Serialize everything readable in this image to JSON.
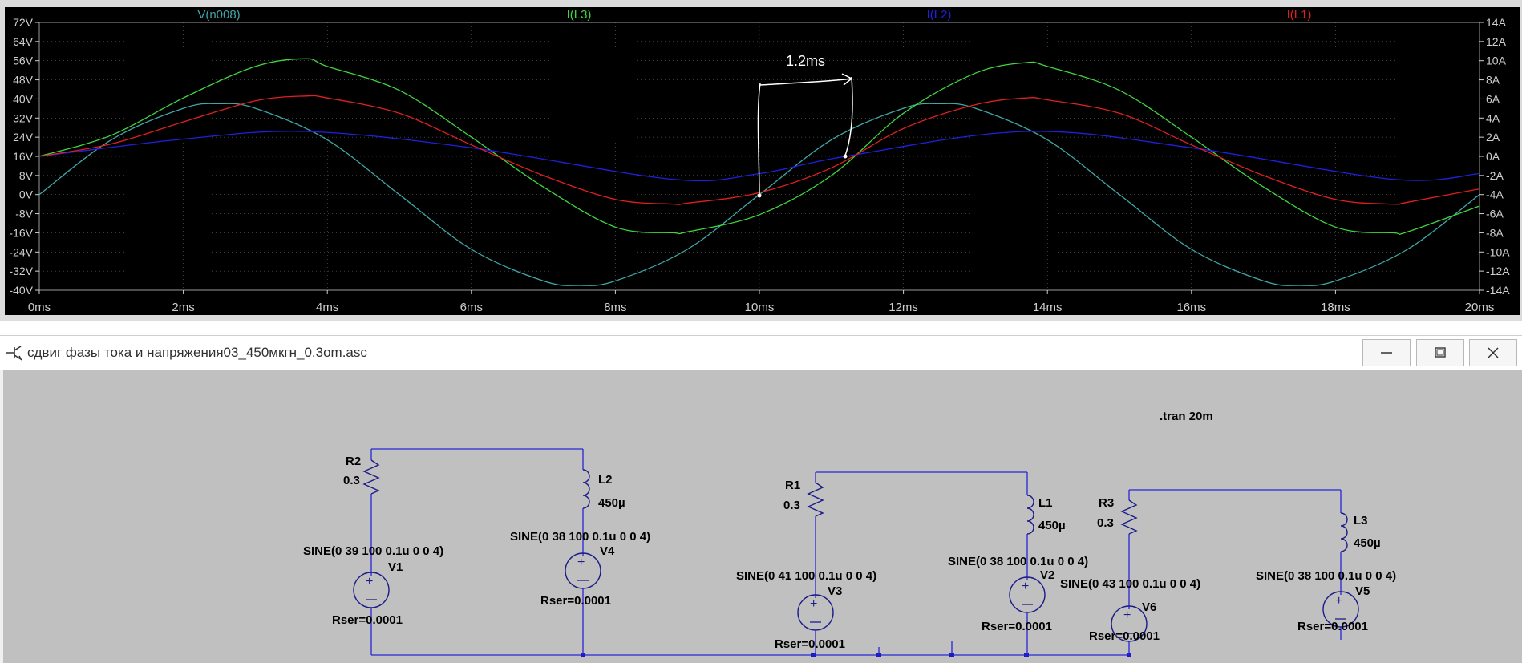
{
  "plot": {
    "legend": [
      {
        "label": "V(n008)",
        "color": "#3fa7a7"
      },
      {
        "label": "I(L3)",
        "color": "#3fd63f"
      },
      {
        "label": "I(L2)",
        "color": "#2020e0"
      },
      {
        "label": "I(L1)",
        "color": "#e02020"
      }
    ],
    "left_axis_ticks": [
      "72V",
      "64V",
      "56V",
      "48V",
      "40V",
      "32V",
      "24V",
      "16V",
      "8V",
      "0V",
      "-8V",
      "-16V",
      "-24V",
      "-32V",
      "-40V"
    ],
    "right_axis_ticks": [
      "14A",
      "12A",
      "10A",
      "8A",
      "6A",
      "4A",
      "2A",
      "0A",
      "-2A",
      "-4A",
      "-6A",
      "-8A",
      "-10A",
      "-12A",
      "-14A"
    ],
    "x_axis_ticks": [
      "0ms",
      "2ms",
      "4ms",
      "6ms",
      "8ms",
      "10ms",
      "12ms",
      "14ms",
      "16ms",
      "18ms",
      "20ms"
    ],
    "annotation": "1.2ms",
    "colors": {
      "background": "#000000",
      "grid": "#7a7a7a",
      "frame": "#9a9a9a",
      "annotation": "#ffffff"
    }
  },
  "chart_data": {
    "type": "line",
    "x_unit": "ms",
    "xlim": [
      0,
      20
    ],
    "left_ylim": [
      -40,
      72
    ],
    "right_ylim": [
      -14,
      14
    ],
    "series": [
      {
        "name": "V(n008)",
        "axis": "left",
        "unit": "V",
        "color": "#3fa7a7",
        "x": [
          0,
          1,
          2,
          2.5,
          3,
          4,
          5,
          6,
          7,
          7.5,
          8,
          9,
          10,
          11,
          12,
          12.5,
          13,
          14,
          15,
          16,
          17,
          17.5,
          18,
          19,
          20
        ],
        "y": [
          0,
          22.9,
          36.1,
          38,
          36.1,
          22.9,
          0,
          -22.9,
          -36.1,
          -38,
          -36.1,
          -22.9,
          0,
          22.9,
          36.1,
          38,
          36.1,
          22.9,
          0,
          -22.9,
          -36.1,
          -38,
          -36.1,
          -22.9,
          0
        ]
      },
      {
        "name": "I(L3)",
        "axis": "right",
        "unit": "A",
        "color": "#3fd63f",
        "x": [
          0,
          1,
          2,
          3,
          3.7,
          4,
          5,
          6,
          7,
          8,
          8.8,
          9,
          10,
          11,
          12,
          13,
          13.7,
          14,
          15,
          16,
          17,
          18,
          18.8,
          19,
          20
        ],
        "y": [
          0,
          2.2,
          6.1,
          9.4,
          10.2,
          9.4,
          6.9,
          2.0,
          -3.2,
          -7.4,
          -8.0,
          -7.9,
          -6.1,
          -2.0,
          4.5,
          8.7,
          9.8,
          9.4,
          6.9,
          2.0,
          -3.2,
          -7.4,
          -8.0,
          -7.9,
          -5.2
        ]
      },
      {
        "name": "I(L2)",
        "axis": "right",
        "unit": "A",
        "color": "#2020e0",
        "x": [
          0,
          2,
          3.7,
          6,
          8.8,
          10,
          11.2,
          13.7,
          16,
          18.8,
          20
        ],
        "y": [
          0,
          1.8,
          2.6,
          0.9,
          -2.4,
          -1.8,
          0,
          2.6,
          0.9,
          -2.4,
          -1.8
        ]
      },
      {
        "name": "I(L1)",
        "axis": "right",
        "unit": "A",
        "color": "#e02020",
        "x": [
          0,
          1,
          2,
          3,
          3.7,
          4,
          5,
          6,
          7,
          8,
          8.8,
          9,
          10,
          11,
          12,
          13,
          13.7,
          14,
          15,
          16,
          17,
          18,
          18.8,
          19,
          20
        ],
        "y": [
          0,
          1.3,
          3.6,
          5.8,
          6.3,
          6.1,
          4.5,
          1.2,
          -2.0,
          -4.5,
          -5.0,
          -4.9,
          -3.8,
          -1.2,
          2.9,
          5.4,
          6.1,
          5.9,
          4.5,
          1.2,
          -2.0,
          -4.5,
          -5.0,
          -4.8,
          -3.4
        ]
      }
    ]
  },
  "schematic_window": {
    "title": "сдвиг фазы тока и напряжения03_450мкгн_0.3om.asc",
    "directive": ".tran 20m",
    "components": {
      "R2": {
        "name": "R2",
        "value": "0.3"
      },
      "L2": {
        "name": "L2",
        "value": "450µ"
      },
      "V1": {
        "name": "V1",
        "spec": "SINE(0 39 100 0.1u 0 0 4)",
        "rser": "Rser=0.0001"
      },
      "V4": {
        "name": "V4",
        "spec": "SINE(0 38 100 0.1u 0 0 4)",
        "rser": "Rser=0.0001"
      },
      "R1": {
        "name": "R1",
        "value": "0.3"
      },
      "L1": {
        "name": "L1",
        "value": "450µ"
      },
      "V3": {
        "name": "V3",
        "spec": "SINE(0 41 100 0.1u 0 0 4)",
        "rser": "Rser=0.0001"
      },
      "V2": {
        "name": "V2",
        "spec": "SINE(0 38 100 0.1u 0 0 4)",
        "rser": "Rser=0.0001"
      },
      "R3": {
        "name": "R3",
        "value": "0.3"
      },
      "L3": {
        "name": "L3",
        "value": "450µ"
      },
      "V6": {
        "name": "V6",
        "spec": "SINE(0 43 100 0.1u 0 0 4)",
        "rser": "Rser=0.0001"
      },
      "V5": {
        "name": "V5",
        "spec": "SINE(0 38 100 0.1u 0 0 4)",
        "rser": "Rser=0.0001"
      }
    },
    "colors": {
      "wire": "#2626d6",
      "junction": "#1c1cc8",
      "text": "#000000"
    }
  }
}
